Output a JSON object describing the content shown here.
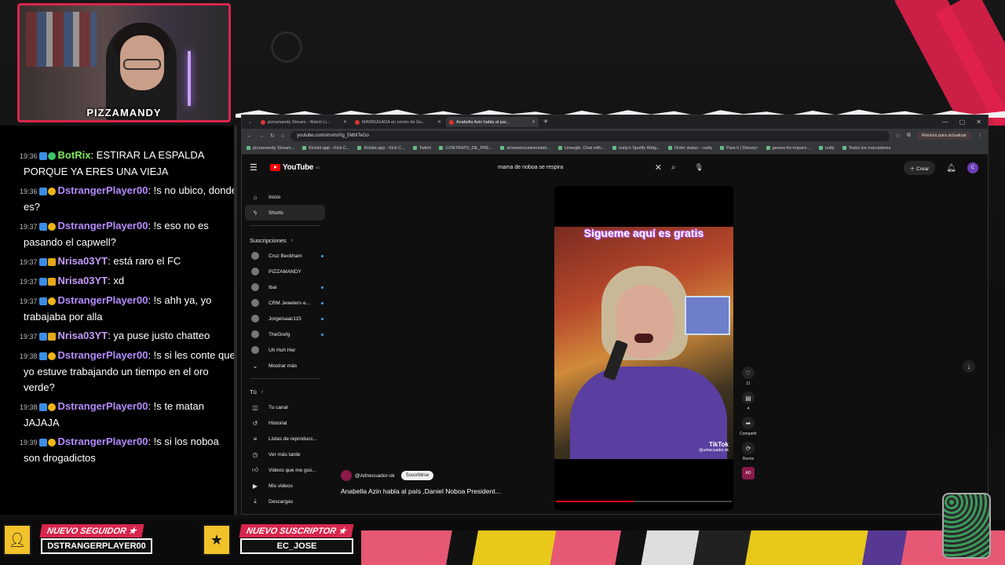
{
  "webcam": {
    "name": "PIZZAMANDY"
  },
  "chat": {
    "messages": [
      {
        "time": "19:36",
        "user": "BotRix",
        "user_color": "#7fe85a",
        "badges": [
          "blue",
          "green"
        ],
        "text": ": ESTIRAR LA ESPALDA PORQUE YA ERES UNA VIEJA"
      },
      {
        "time": "19:36",
        "user": "DstrangerPlayer00",
        "user_color": "#b48cff",
        "badges": [
          "blue",
          "yellow"
        ],
        "text": ": !s no ubico, donde es?"
      },
      {
        "time": "19:37",
        "user": "DstrangerPlayer00",
        "user_color": "#b48cff",
        "badges": [
          "blue",
          "yellow"
        ],
        "text": ": !s eso no es pasando el capwell?"
      },
      {
        "time": "19:37",
        "user": "Nrisa03YT",
        "user_color": "#c89bff",
        "badges": [
          "blue",
          "gold"
        ],
        "text": ": está raro el FC"
      },
      {
        "time": "19:37",
        "user": "Nrisa03YT",
        "user_color": "#c89bff",
        "badges": [
          "blue",
          "gold"
        ],
        "text": ": xd"
      },
      {
        "time": "19:37",
        "user": "DstrangerPlayer00",
        "user_color": "#b48cff",
        "badges": [
          "blue",
          "yellow"
        ],
        "text": ": !s ahh ya, yo trabajaba por alla"
      },
      {
        "time": "19:37",
        "user": "Nrisa03YT",
        "user_color": "#c89bff",
        "badges": [
          "blue",
          "gold"
        ],
        "text": ": ya puse justo chatteo"
      },
      {
        "time": "19:38",
        "user": "DstrangerPlayer00",
        "user_color": "#b48cff",
        "badges": [
          "blue",
          "yellow"
        ],
        "text": ": !s si les conte que yo estuve trabajando un tiempo en el oro verde?"
      },
      {
        "time": "19:38",
        "user": "DstrangerPlayer00",
        "user_color": "#b48cff",
        "badges": [
          "blue",
          "yellow"
        ],
        "text": ": !s te matan JAJAJA"
      },
      {
        "time": "19:39",
        "user": "DstrangerPlayer00",
        "user_color": "#b48cff",
        "badges": [
          "blue",
          "yellow"
        ],
        "text": ": !s si los noboa son drogadictos"
      }
    ]
  },
  "browser": {
    "tabs": [
      {
        "label": "pizzamandy Stream - Watch Li...",
        "active": false
      },
      {
        "label": "MADRUGADA en centro de Gu...",
        "active": false
      },
      {
        "label": "Anabella Azin habla al pai...",
        "active": true
      }
    ],
    "url": "youtube.com/shorts/0g_5MbITeGo",
    "update_label": "Reinicia para actualizar",
    "bookmarks": [
      "pizzamandy Stream...",
      "Kicklet.app - Kick C...",
      "Kicklet.app - Kick C...",
      "Twitch",
      "CONTRATO_DE_PRE...",
      "streamersuniversitari...",
      "Uneegle: Chat with...",
      "nutty's Spotify Widg...",
      "Order status – nutty",
      "Para ti | Disney+",
      "games-for-impact-...",
      "nutty",
      "Todos los marcadores"
    ]
  },
  "youtube": {
    "logo": "YouTube",
    "logo_sup": "EC",
    "search_query": "mama de noboa se respira",
    "create_label": "Crear",
    "avatar_letter": "C",
    "nav": [
      {
        "label": "Inicio",
        "icon": "home-icon"
      },
      {
        "label": "Shorts",
        "icon": "shorts-icon"
      }
    ],
    "subs_title": "Suscripciones",
    "subscriptions": [
      {
        "label": "Cruz Beckham",
        "dot": true
      },
      {
        "label": "PIZZAMANDY",
        "dot": false
      },
      {
        "label": "Ibai",
        "dot": true
      },
      {
        "label": "CRM Jewelers e...",
        "dot": true
      },
      {
        "label": "Jorgeisaac115",
        "dot": true
      },
      {
        "label": "TheGrefg",
        "dot": true
      },
      {
        "label": "Uh Huh Her",
        "dot": false
      }
    ],
    "show_more": "Mostrar más",
    "you_title": "Tú",
    "you_items": [
      {
        "label": "Tu canal",
        "icon": "channel-icon"
      },
      {
        "label": "Historial",
        "icon": "history-icon"
      },
      {
        "label": "Listas de reproducc...",
        "icon": "playlist-icon"
      },
      {
        "label": "Ver más tarde",
        "icon": "clock-icon"
      },
      {
        "label": "Videos que me gus...",
        "icon": "like-icon"
      },
      {
        "label": "Mis videos",
        "icon": "video-icon"
      },
      {
        "label": "Descargas",
        "icon": "download-icon"
      }
    ],
    "short": {
      "banner": "Sigueme aquí es gratis",
      "watermark": "TikTok",
      "watermark_handle": "@adnecuador.ok",
      "progress": 0.44,
      "channel": "@Adnecuador-ok",
      "subscribe": "Suscribirse",
      "title": "Anabella Azin habla al país ,Daniel Noboa President...",
      "likes": "11",
      "comments": "4",
      "share": "Compartir",
      "remix": "Remix"
    }
  },
  "alerts": {
    "follower_label": "NUEVO SEGUIDOR ★",
    "follower_name": "DSTRANGERPLAYER00",
    "sub_label": "NUEVO SUSCRIPTOR ★",
    "sub_name": "EC_JOSE"
  }
}
